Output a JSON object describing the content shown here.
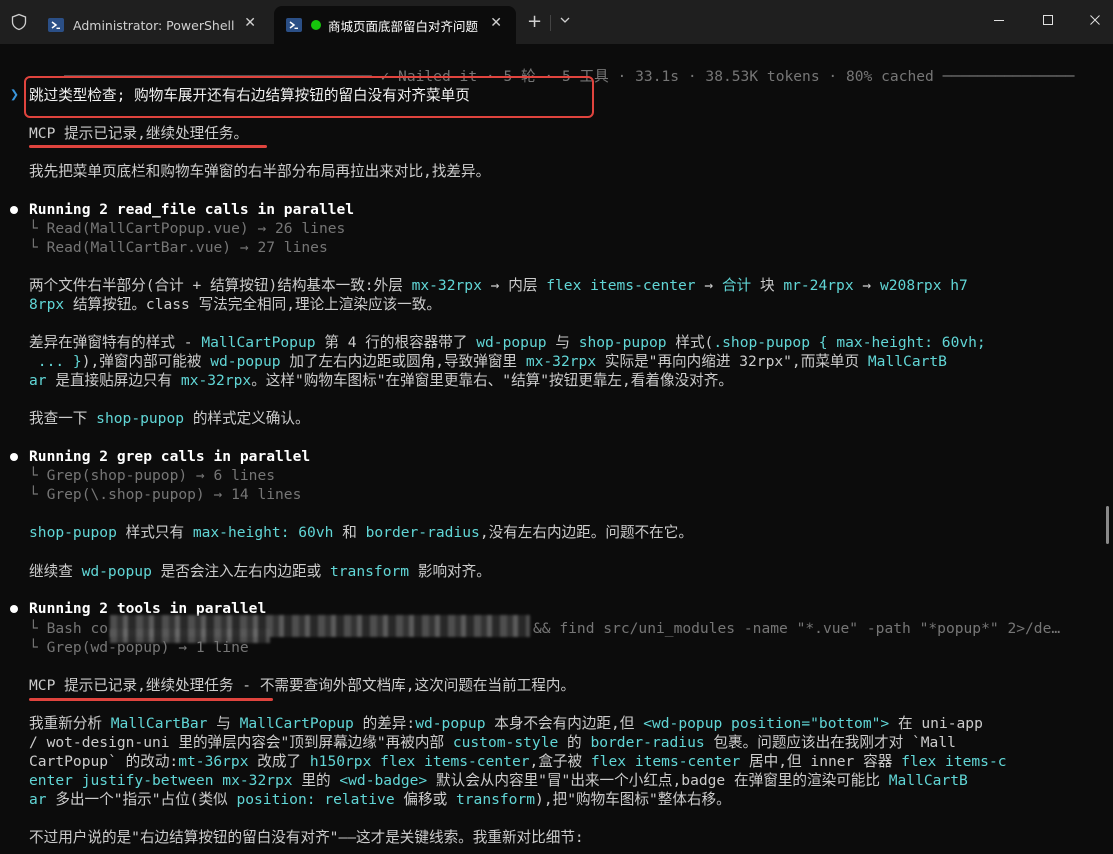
{
  "window": {
    "tabs": [
      {
        "label": "Administrator: PowerShell",
        "active": false
      },
      {
        "label": "商城页面底部留白对齐问题",
        "active": true
      }
    ],
    "new_tab_label": "+",
    "colors": {
      "background": "#0c0c0c",
      "titlebar": "#1f1f1f",
      "accent_cyan": "#61d6d6",
      "prompt_blue": "#3a96dd",
      "highlight_red": "#e0443e",
      "status_green": "#16c60c"
    }
  },
  "terminal": {
    "status_line": "✓ Nailed it · 5 轮 · 5 工具 · 33.1s · 38.53K tokens · 80% cached",
    "prompt_symbol": "❯",
    "user_prompt": "跳过类型检查; 购物车展开还有右边结算按钮的留白没有对齐菜单页",
    "mcp1": "MCP 提示已记录,继续处理任务。",
    "p1": "我先把菜单页底栏和购物车弹窗的右半部分布局再拉出来对比,找差异。",
    "run1": {
      "title": "Running 2 read_file calls in parallel",
      "items": [
        "└ Read(MallCartPopup.vue) → 26 lines",
        "└ Read(MallCartBar.vue) → 27 lines"
      ]
    },
    "p2": {
      "l1": [
        "两个文件右半部分(合计 + 结算按钮)结构基本一致:外层 ",
        "mx-32rpx",
        " → 内层 ",
        "flex items-center",
        " → ",
        "合计",
        " 块 ",
        "mr-24rpx",
        " → ",
        "w208rpx h7"
      ],
      "l2": [
        "8rpx",
        " 结算按钮。class 写法完全相同,理论上渲染应该一致。"
      ]
    },
    "p3": {
      "l1": [
        "差异在弹窗特有的样式 - ",
        "MallCartPopup",
        " 第 4 行的根容器带了 ",
        "wd-popup",
        " 与 ",
        "shop-pupop",
        " 样式(",
        ".shop-pupop { max-height: 60vh;"
      ],
      "l2": [
        " ... }",
        "),弹窗内部可能被 ",
        "wd-popup",
        " 加了左右内边距或圆角,导致弹窗里 ",
        "mx-32rpx",
        " 实际是\"再向内缩进 32rpx\",而菜单页 ",
        "MallCartB"
      ],
      "l3": [
        "ar",
        " 是直接贴屏边只有 ",
        "mx-32rpx",
        "。这样\"购物车图标\"在弹窗里更靠右、\"结算\"按钮更靠左,看着像没对齐。"
      ]
    },
    "p4": [
      "我查一下 ",
      "shop-pupop",
      " 的样式定义确认。"
    ],
    "run2": {
      "title": "Running 2 grep calls in parallel",
      "items": [
        "└ Grep(shop-pupop) → 6 lines",
        "└ Grep(\\.shop-pupop) → 14 lines"
      ]
    },
    "p5": [
      "shop-pupop",
      " 样式只有 ",
      "max-height: 60vh",
      " 和 ",
      "border-radius",
      ",没有左右内边距。问题不在它。"
    ],
    "p6": [
      "继续查 ",
      "wd-popup",
      " 是否会注入左右内边距或 ",
      "transform",
      " 影响对齐。"
    ],
    "run3": {
      "title": "Running 2 tools in parallel",
      "item1_start": "└ Bash co",
      "item1_end": "&& find src/uni_modules -name \"*.vue\" -path \"*popup*\" 2>/de…",
      "item2": "└ Grep(wd-popup) → 1 line"
    },
    "mcp2": [
      "MCP 提示已记录,继续处理任务",
      " - 不需要查询外部文档库,这次问题在当前工程内。"
    ],
    "p7": {
      "l1": [
        "我重新分析 ",
        "MallCartBar",
        " 与 ",
        "MallCartPopup",
        " 的差异:",
        "wd-popup",
        " 本身不会有内边距,但 ",
        "<wd-popup position=\"bottom\">",
        " 在 uni-app"
      ],
      "l2": [
        "/ wot-design-uni 里的弹层内容会\"顶到屏幕边缘\"再被内部 ",
        "custom-style",
        " 的 ",
        "border-radius",
        " 包裹。问题应该出在我刚才对 `Mall"
      ],
      "l3": [
        "CartPopup` 的改动:",
        "mt-36rpx",
        " 改成了 ",
        "h150rpx flex items-center",
        ",盒子被 ",
        "flex items-center",
        " 居中,但 inner 容器 ",
        "flex items-c"
      ],
      "l4": [
        "enter justify-between mx-32rpx",
        " 里的 ",
        "<wd-badge>",
        " 默认会从内容里\"冒\"出来一个小红点,badge 在弹窗里的渲染可能比 ",
        "MallCartB"
      ],
      "l5": [
        "ar",
        " 多出一个\"指示\"占位(类似 ",
        "position: relative",
        " 偏移或 ",
        "transform",
        "),把\"购物车图标\"整体右移。"
      ]
    },
    "p8": "不过用户说的是\"右边结算按钮的留白没有对齐\"——这才是关键线索。我重新对比细节:"
  }
}
